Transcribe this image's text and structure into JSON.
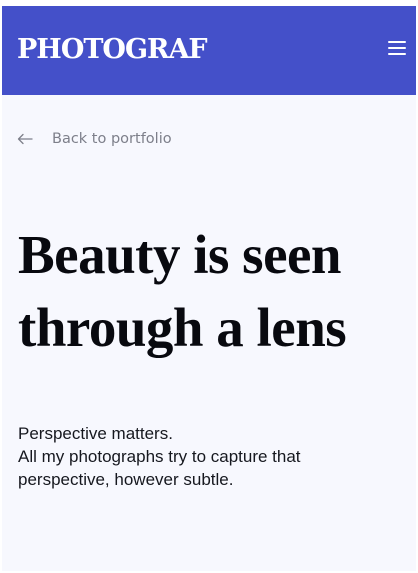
{
  "header": {
    "brand": "PHOTOGRAF",
    "menu_icon": "hamburger-menu-icon"
  },
  "nav": {
    "back_icon": "arrow-left-icon",
    "back_label": "Back to portfolio"
  },
  "main": {
    "headline_line1": "Beauty is seen",
    "headline_line2": "through a lens",
    "body_line1": "Perspective matters.",
    "body_line2": "All my photographs try to capture that",
    "body_line3": "perspective, however subtle."
  },
  "colors": {
    "header_background": "#4450c9",
    "page_background": "#f7f8fe",
    "headline_text": "#08090f",
    "muted_text": "#7d7f8a"
  }
}
